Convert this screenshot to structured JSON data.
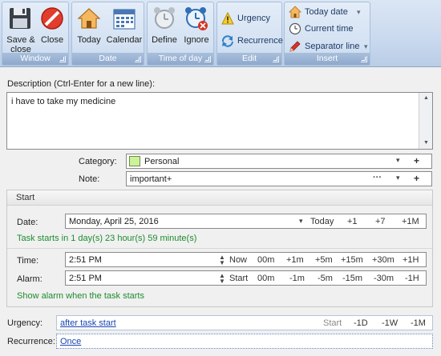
{
  "ribbon": {
    "groups": {
      "window": "Window",
      "date": "Date",
      "time_of_day": "Time of day",
      "edit": "Edit",
      "insert": "Insert"
    },
    "buttons": {
      "save_close": "Save & close",
      "close": "Close",
      "today": "Today",
      "calendar": "Calendar",
      "define": "Define",
      "ignore": "Ignore",
      "urgency": "Urgency",
      "recurrence": "Recurrence",
      "today_date": "Today date",
      "current_time": "Current time",
      "separator_line": "Separator line"
    }
  },
  "description": {
    "label": "Description (Ctrl-Enter for a new line):",
    "value": "i have to take my medicine"
  },
  "category": {
    "label": "Category:",
    "value": "Personal",
    "swatch_color": "#ccf29a"
  },
  "note": {
    "label": "Note:",
    "value": "important+",
    "more": "···"
  },
  "start": {
    "title": "Start",
    "date_label": "Date:",
    "date_value": "Monday, April 25, 2016",
    "date_shortcuts": [
      "Today",
      "+1",
      "+7",
      "+1M"
    ],
    "starts_in": "Task starts in 1 day(s) 23 hour(s) 59 minute(s)",
    "time_label": "Time:",
    "time_value": "2:51 PM",
    "time_shortcuts": [
      "Now",
      "00m",
      "+1m",
      "+5m",
      "+15m",
      "+30m",
      "+1H"
    ],
    "alarm_label": "Alarm:",
    "alarm_value": "2:51 PM",
    "alarm_shortcuts": [
      "Start",
      "00m",
      "-1m",
      "-5m",
      "-15m",
      "-30m",
      "-1H"
    ],
    "alarm_note": "Show alarm when the task starts"
  },
  "urgency": {
    "label": "Urgency:",
    "value": "after task start",
    "shortcuts": [
      "Start",
      "-1D",
      "-1W",
      "-1M"
    ]
  },
  "recurrence": {
    "label": "Recurrence:",
    "value": "Once"
  },
  "colors": {
    "accent_green": "#1e8c2e",
    "link_blue": "#1a44b0",
    "ribbon_blue": "#c9d9ee"
  }
}
